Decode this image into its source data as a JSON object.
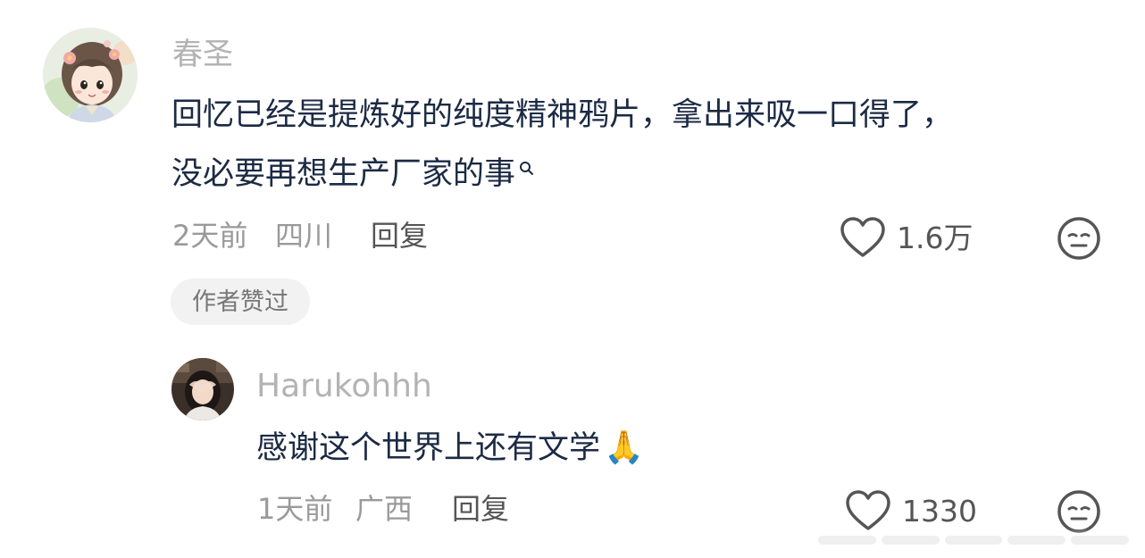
{
  "comment": {
    "username": "春圣",
    "text_line1": "回忆已经是提炼好的纯度精神鸦片，拿出来吸一口得了，",
    "text_line2": "没必要再想生产厂家的事",
    "time": "2天前",
    "location": "四川",
    "reply_label": "回复",
    "like_count": "1.6万",
    "author_badge": "作者赞过",
    "avatar_icon": "cartoon-girl-avatar",
    "search_icon": "search-icon",
    "like_icon": "heart-icon",
    "dislike_icon": "meh-face-icon"
  },
  "reply": {
    "username": "Harukohhh",
    "text": "感谢这个世界上还有文学",
    "emoji": "🙏",
    "time": "1天前",
    "location": "广西",
    "reply_label": "回复",
    "like_count": "1330",
    "avatar_icon": "photo-avatar",
    "like_icon": "heart-icon",
    "dislike_icon": "meh-face-icon"
  },
  "colors": {
    "text_primary": "#1c2a44",
    "username": "#b3b3b3",
    "meta": "#9a9a9a",
    "action": "#555555",
    "badge_bg": "#f2f2f2"
  }
}
